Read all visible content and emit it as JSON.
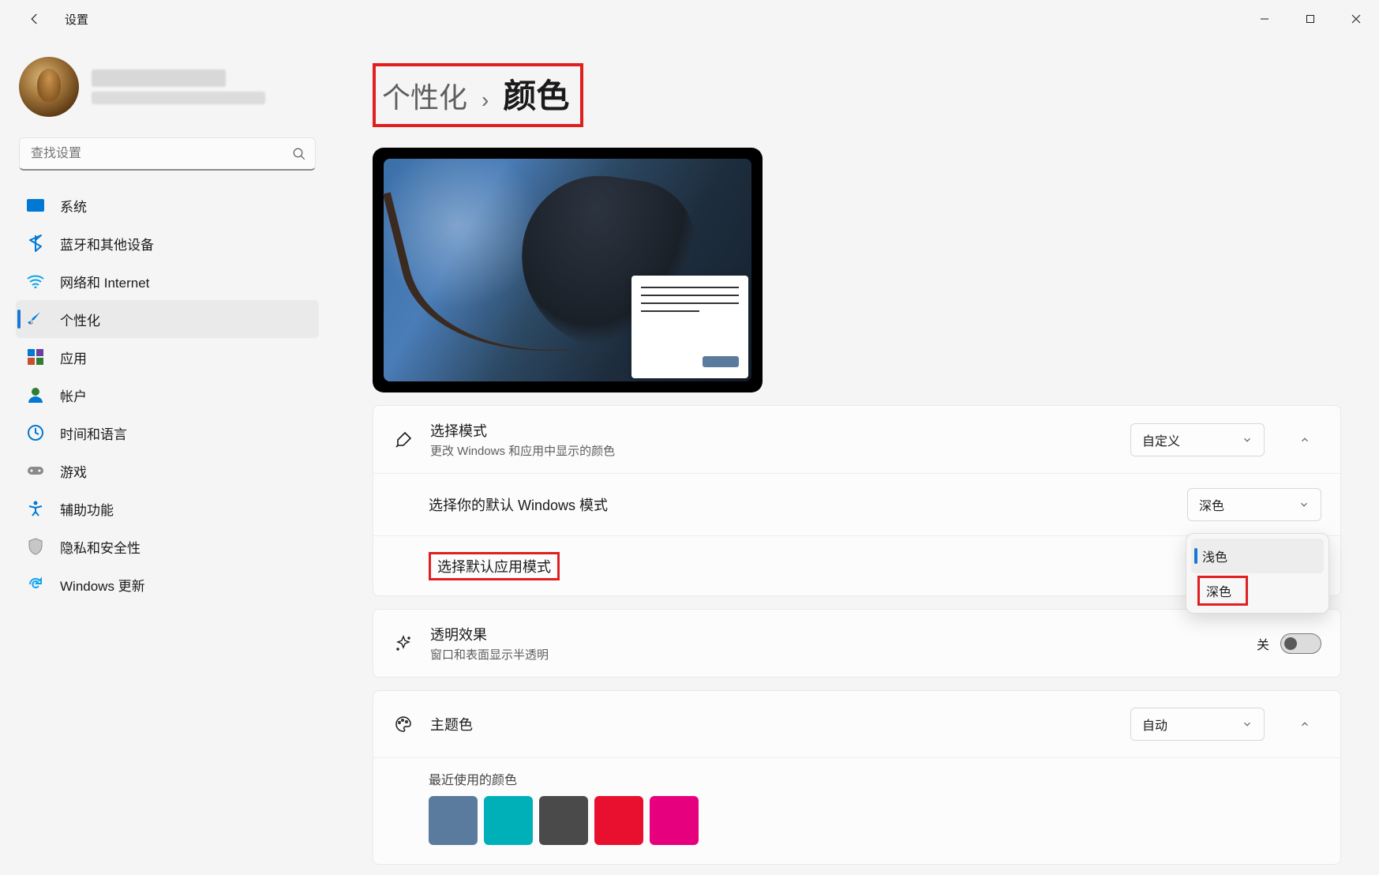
{
  "app_title": "设置",
  "search": {
    "placeholder": "查找设置"
  },
  "sidebar": {
    "items": [
      {
        "label": "系统"
      },
      {
        "label": "蓝牙和其他设备"
      },
      {
        "label": "网络和 Internet"
      },
      {
        "label": "个性化"
      },
      {
        "label": "应用"
      },
      {
        "label": "帐户"
      },
      {
        "label": "时间和语言"
      },
      {
        "label": "游戏"
      },
      {
        "label": "辅助功能"
      },
      {
        "label": "隐私和安全性"
      },
      {
        "label": "Windows 更新"
      }
    ]
  },
  "breadcrumb": {
    "parent": "个性化",
    "sep": "›",
    "current": "颜色"
  },
  "rows": {
    "mode": {
      "title": "选择模式",
      "desc": "更改 Windows 和应用中显示的颜色",
      "value": "自定义"
    },
    "win_mode": {
      "title": "选择你的默认 Windows 模式",
      "value": "深色"
    },
    "app_mode": {
      "title": "选择默认应用模式"
    },
    "transparency": {
      "title": "透明效果",
      "desc": "窗口和表面显示半透明",
      "state_label": "关"
    },
    "accent": {
      "title": "主题色",
      "value": "自动"
    },
    "recent_title": "最近使用的颜色"
  },
  "app_mode_options": [
    {
      "label": "浅色",
      "selected": true
    },
    {
      "label": "深色",
      "selected": false
    }
  ],
  "recent_colors": [
    "#5a7a9e",
    "#00b0b9",
    "#4a4a4a",
    "#e8102e",
    "#e6007e"
  ]
}
